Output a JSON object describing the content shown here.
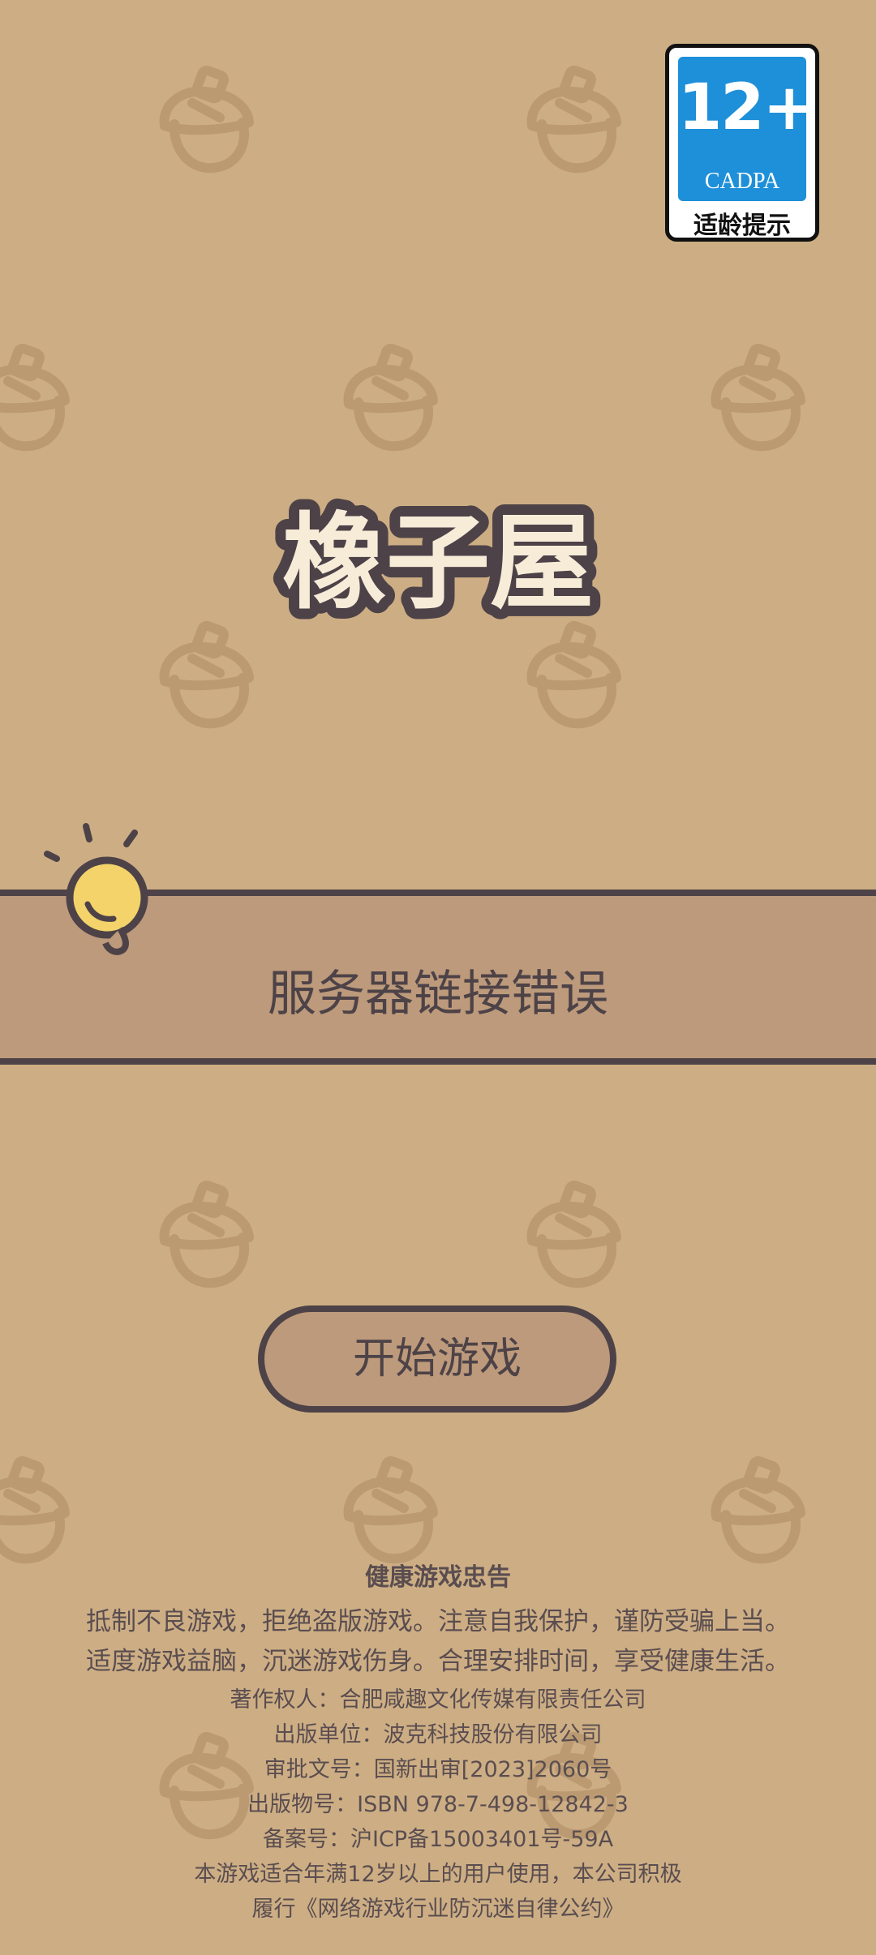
{
  "age_badge": {
    "number": "12+",
    "org": "CADPA",
    "label": "适龄提示"
  },
  "logo": {
    "title": "橡子屋"
  },
  "banner": {
    "message": "服务器链接错误"
  },
  "start_button": {
    "label": "开始游戏"
  },
  "footer": {
    "title": "健康游戏忠告",
    "advice_line1": "抵制不良游戏，拒绝盗版游戏。注意自我保护，谨防受骗上当。",
    "advice_line2": "适度游戏益脑，沉迷游戏伤身。合理安排时间，享受健康生活。",
    "copyright": "著作权人：合肥咸趣文化传媒有限责任公司",
    "publisher": "出版单位：波克科技股份有限公司",
    "approval": "审批文号：国新出审[2023]2060号",
    "isbn": "出版物号：ISBN 978-7-498-12842-3",
    "icp": "备案号：沪ICP备15003401号-59A",
    "age_note_line1": "本游戏适合年满12岁以上的用户使用，本公司积极",
    "age_note_line2": "履行《网络游戏行业防沉迷自律公约》"
  },
  "colors": {
    "background": "#cdae84",
    "acorn_pattern": "#bb9a72",
    "banner": "#bc9a7b",
    "outline": "#4d4247",
    "bulb": "#f3d36a",
    "badge_blue": "#1e8fd9"
  }
}
